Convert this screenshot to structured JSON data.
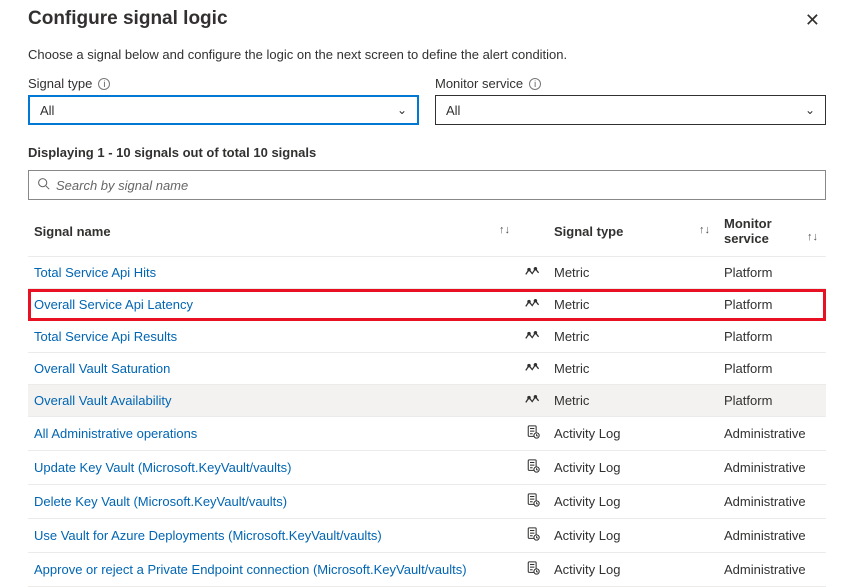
{
  "header": {
    "title": "Configure signal logic",
    "subtitle": "Choose a signal below and configure the logic on the next screen to define the alert condition."
  },
  "selectors": {
    "signalType": {
      "label": "Signal type",
      "value": "All"
    },
    "monitorService": {
      "label": "Monitor service",
      "value": "All"
    }
  },
  "displayingText": "Displaying 1 - 10 signals out of total 10 signals",
  "search": {
    "placeholder": "Search by signal name"
  },
  "columns": {
    "name": "Signal name",
    "type": "Signal type",
    "service": "Monitor service"
  },
  "rows": [
    {
      "name": "Total Service Api Hits",
      "icon": "metric",
      "type": "Metric",
      "service": "Platform",
      "highlight": false,
      "hovered": false
    },
    {
      "name": "Overall Service Api Latency",
      "icon": "metric",
      "type": "Metric",
      "service": "Platform",
      "highlight": true,
      "hovered": false
    },
    {
      "name": "Total Service Api Results",
      "icon": "metric",
      "type": "Metric",
      "service": "Platform",
      "highlight": false,
      "hovered": false
    },
    {
      "name": "Overall Vault Saturation",
      "icon": "metric",
      "type": "Metric",
      "service": "Platform",
      "highlight": false,
      "hovered": false
    },
    {
      "name": "Overall Vault Availability",
      "icon": "metric",
      "type": "Metric",
      "service": "Platform",
      "highlight": false,
      "hovered": true
    },
    {
      "name": "All Administrative operations",
      "icon": "log",
      "type": "Activity Log",
      "service": "Administrative",
      "highlight": false,
      "hovered": false
    },
    {
      "name": "Update Key Vault (Microsoft.KeyVault/vaults)",
      "icon": "log",
      "type": "Activity Log",
      "service": "Administrative",
      "highlight": false,
      "hovered": false
    },
    {
      "name": "Delete Key Vault (Microsoft.KeyVault/vaults)",
      "icon": "log",
      "type": "Activity Log",
      "service": "Administrative",
      "highlight": false,
      "hovered": false
    },
    {
      "name": "Use Vault for Azure Deployments (Microsoft.KeyVault/vaults)",
      "icon": "log",
      "type": "Activity Log",
      "service": "Administrative",
      "highlight": false,
      "hovered": false
    },
    {
      "name": "Approve or reject a Private Endpoint connection (Microsoft.KeyVault/vaults)",
      "icon": "log",
      "type": "Activity Log",
      "service": "Administrative",
      "highlight": false,
      "hovered": false
    }
  ]
}
